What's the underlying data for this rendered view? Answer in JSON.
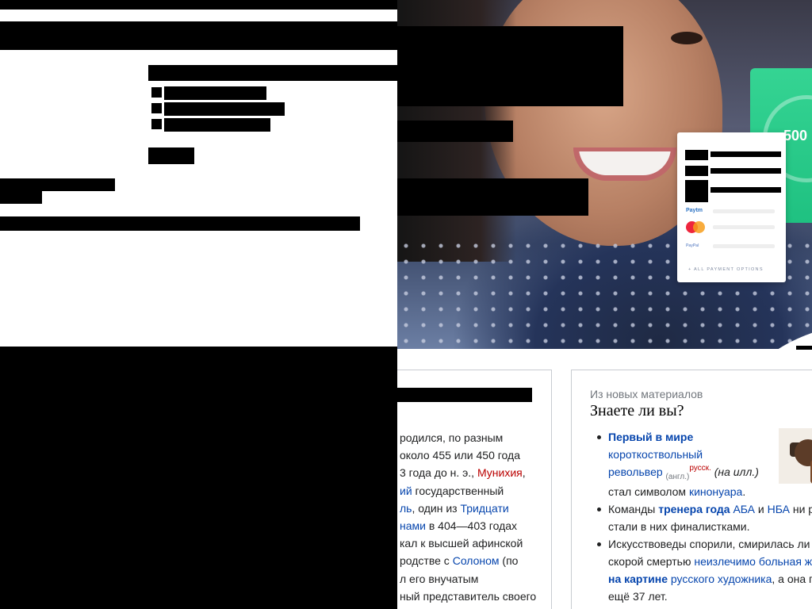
{
  "hero": {
    "pay_card": {
      "paytm_label": "Paytm",
      "paypal_label": "PayPal",
      "all_options_label": "+ ALL PAYMENT OPTIONS"
    },
    "green_card": {
      "amount": "500"
    }
  },
  "left_panel": {
    "lines": [
      [
        {
          "t": "родился, по разным",
          "c": ""
        }
      ],
      [
        {
          "t": "около 455 или 450 года",
          "c": ""
        }
      ],
      [
        {
          "t": "3 года до н. э., ",
          "c": ""
        },
        {
          "t": "Мунихия",
          "c": "red"
        },
        {
          "t": ",",
          "c": ""
        }
      ],
      [
        {
          "t": "ий",
          "c": "lnk"
        },
        {
          "t": " государственный",
          "c": ""
        }
      ],
      [
        {
          "t": "ль",
          "c": "lnk"
        },
        {
          "t": ", один из ",
          "c": ""
        },
        {
          "t": "Тридцати",
          "c": "lnk"
        }
      ],
      [
        {
          "t": "нами",
          "c": "lnk"
        },
        {
          "t": " в 404—403 годах",
          "c": ""
        }
      ],
      [
        {
          "t": "кал к высшей афинской",
          "c": ""
        }
      ],
      [
        {
          "t": "родстве с ",
          "c": ""
        },
        {
          "t": "Солоном",
          "c": "lnk"
        },
        {
          "t": " (по",
          "c": ""
        }
      ],
      [
        {
          "t": "л его внучатым",
          "c": ""
        }
      ],
      [
        {
          "t": "ный представитель своего",
          "c": ""
        }
      ]
    ]
  },
  "right_panel": {
    "subtitle": "Из новых материалов",
    "heading": "Знаете ли вы?",
    "items": [
      {
        "lines": [
          [
            {
              "t": "Первый в мире",
              "c": "lnk b"
            }
          ],
          [
            {
              "t": "короткоствольный",
              "c": "lnk"
            }
          ],
          [
            {
              "t": "револьвер",
              "c": "lnk"
            },
            {
              "t": " ",
              "c": ""
            },
            {
              "t": "(англ.)",
              "c": "sub"
            },
            {
              "t": "русск.",
              "c": "sup"
            },
            {
              "t": " (на илл.)",
              "c": "it"
            }
          ],
          [
            {
              "t": "стал символом ",
              "c": ""
            },
            {
              "t": "кинонуара",
              "c": "lnk"
            },
            {
              "t": ".",
              "c": ""
            }
          ]
        ]
      },
      {
        "lines": [
          [
            {
              "t": "Команды ",
              "c": ""
            },
            {
              "t": "тренера года",
              "c": "lnk b"
            },
            {
              "t": " ",
              "c": ""
            },
            {
              "t": "АБА",
              "c": "lnk"
            },
            {
              "t": " и ",
              "c": ""
            },
            {
              "t": "НБА",
              "c": "lnk"
            },
            {
              "t": " ни р",
              "c": ""
            }
          ],
          [
            {
              "t": "стали в них финалистками.",
              "c": ""
            }
          ]
        ]
      },
      {
        "lines": [
          [
            {
              "t": "Искусствоведы спорили, смирилась ли",
              "c": ""
            }
          ],
          [
            {
              "t": "скорой смертью ",
              "c": ""
            },
            {
              "t": "неизлечимо больная ж",
              "c": "lnk"
            }
          ],
          [
            {
              "t": "на картине",
              "c": "lnk b"
            },
            {
              "t": " ",
              "c": ""
            },
            {
              "t": "русского художника",
              "c": "lnk"
            },
            {
              "t": ", а она г",
              "c": ""
            }
          ],
          [
            {
              "t": "ещё 37 лет.",
              "c": ""
            }
          ]
        ]
      }
    ]
  },
  "colors": {
    "link": "#0645ad",
    "red_link": "#ba0000",
    "accent_green": "#1fc181",
    "border": "#c8ccd1"
  }
}
